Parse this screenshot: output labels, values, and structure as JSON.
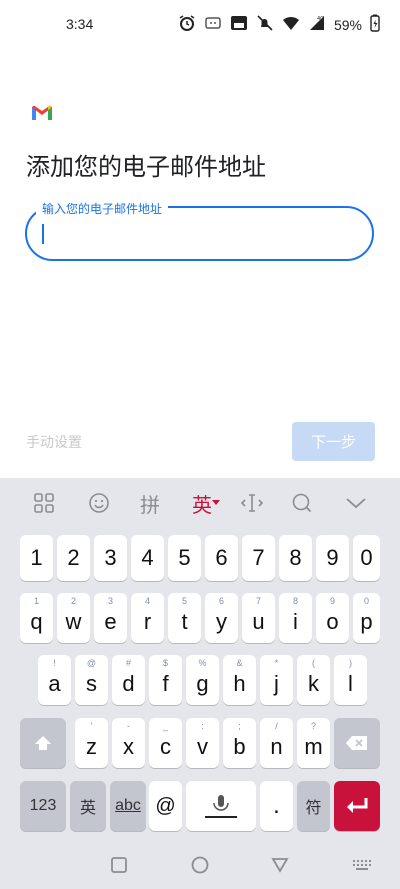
{
  "status_bar": {
    "time": "3:34",
    "battery": "59%",
    "icons": [
      "alarm-icon",
      "app-notification-icon",
      "volte-icon",
      "mute-icon",
      "wifi-icon",
      "signal-4g-icon",
      "battery-icon"
    ]
  },
  "app": {
    "logo": "gmail-logo"
  },
  "page": {
    "title": "添加您的电子邮件地址",
    "email_label": "输入您的电子邮件地址",
    "email_value": "",
    "manual_setup": "手动设置",
    "next_button": "下一步"
  },
  "keyboard": {
    "toolbar": {
      "mode_label": "英",
      "pinyin_label": "拼"
    },
    "number_row": [
      "1",
      "2",
      "3",
      "4",
      "5",
      "6",
      "7",
      "8",
      "9",
      "0"
    ],
    "row1": {
      "keys": [
        "q",
        "w",
        "e",
        "r",
        "t",
        "y",
        "u",
        "i",
        "o",
        "p"
      ],
      "subs": [
        "1",
        "2",
        "3",
        "4",
        "5",
        "6",
        "7",
        "8",
        "9",
        "0"
      ]
    },
    "row2": {
      "keys": [
        "a",
        "s",
        "d",
        "f",
        "g",
        "h",
        "j",
        "k",
        "l"
      ],
      "subs": [
        "!",
        "@",
        "#",
        "$",
        "%",
        "&",
        "*",
        "(",
        ")"
      ]
    },
    "row3": {
      "keys": [
        "z",
        "x",
        "c",
        "v",
        "b",
        "n",
        "m"
      ],
      "subs": [
        "'",
        "-",
        "_",
        ":",
        ";",
        "/",
        "?"
      ]
    },
    "bottom": {
      "num_label": "123",
      "lang_label": "英",
      "abc_label": "abc",
      "at_label": "@",
      "period_label": ".",
      "symbol_label": "符"
    }
  },
  "colors": {
    "accent": "#1a73e8",
    "enter": "#c8113b",
    "keyboard_bg": "#e5e6eb"
  }
}
